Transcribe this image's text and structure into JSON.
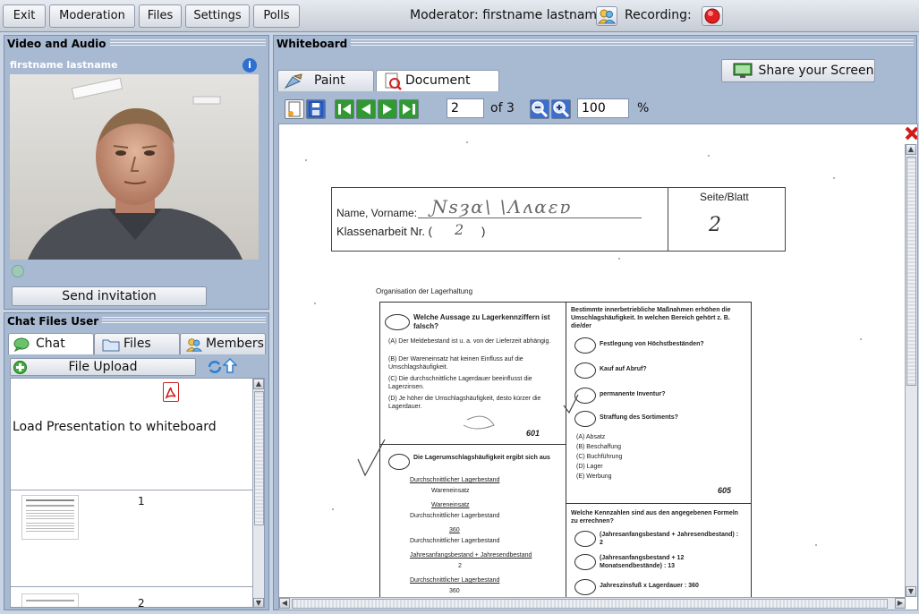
{
  "toolbar": {
    "menu": [
      "Exit",
      "Moderation",
      "Files",
      "Settings",
      "Polls"
    ],
    "moderator_label": "Moderator: firstname lastname",
    "recording_label": "Recording:"
  },
  "video_panel": {
    "title": "Video and Audio",
    "user_name": "firstname lastname",
    "send_invitation": "Send invitation"
  },
  "chat_panel": {
    "title": "Chat Files User",
    "tabs": [
      "Chat",
      "Files",
      "Members"
    ],
    "file_upload": "File Upload",
    "load_presentation": "Load Presentation to whiteboard",
    "thumbnails": [
      "1",
      "2"
    ]
  },
  "whiteboard": {
    "title": "Whiteboard",
    "tabs": [
      "Paint",
      "Document"
    ],
    "share_screen": "Share your Screen",
    "page_value": "2",
    "page_total": "of 3",
    "zoom_value": "100",
    "zoom_unit": "%"
  },
  "document": {
    "name_label": "Name, Vorname:",
    "klassen_label": "Klassenarbeit Nr. (",
    "klassen_number": "2",
    "seite_label": "Seite/Blatt",
    "seite_value": "2",
    "section_heading": "Organisation der Lagerhaltung",
    "q1_title": "Welche Aussage zu Lagerkennziffern ist falsch?",
    "q1_answers": [
      "(A)  Der Meldebestand ist u. a. von der Lieferzeit abhängig.",
      "(B)  Der Wareneinsatz hat keinen Einfluss auf die Umschlagshäufigkeit.",
      "(C)  Die durchschnittliche Lagerdauer beeinflusst die Lagerzinsen.",
      "(D)  Je höher die Umschlagshäufigkeit, desto kürzer die Lagerdauer."
    ],
    "q1_score": "601",
    "q2_title": "Bestimmte innerbetriebliche Maßnahmen erhöhen die Umschlagshäufigkeit. In welchen Bereich gehört z. B. die/der",
    "q2_answers": [
      "Festlegung von Höchstbeständen?",
      "Kauf auf Abruf?",
      "permanente Inventur?",
      "Straffung des Sortiments?"
    ],
    "q2_options": [
      "(A)  Absatz",
      "(B)  Beschaffung",
      "(C)  Buchführung",
      "(D)  Lager",
      "(E)  Werbung"
    ],
    "q2_score": "605",
    "q3_title": "Die Lagerumschlagshäufigkeit ergibt sich aus",
    "q3_lines": [
      "Durchschnittlicher Lagerbestand",
      "Wareneinsatz",
      "Wareneinsatz",
      "Durchschnittlicher Lagerbestand",
      "360",
      "Durchschnittlicher Lagerbestand",
      "Jahresanfangsbestand + Jahresendbestand",
      "2",
      "Durchschnittlicher Lagerbestand",
      "360"
    ],
    "q4_title": "Welche Kennzahlen sind aus den angegebenen Formeln zu errechnen?",
    "q4_answers": [
      "(Jahresanfangsbestand + Jahresendbestand) : 2",
      "(Jahresanfangsbestand + 12 Monatsendbestände) : 13",
      "Jahreszinsfuß x Lagerdauer : 360"
    ]
  },
  "colors": {
    "panel": "#a8b9d2",
    "record": "#e02020",
    "toolbar": "#d7dce4"
  }
}
